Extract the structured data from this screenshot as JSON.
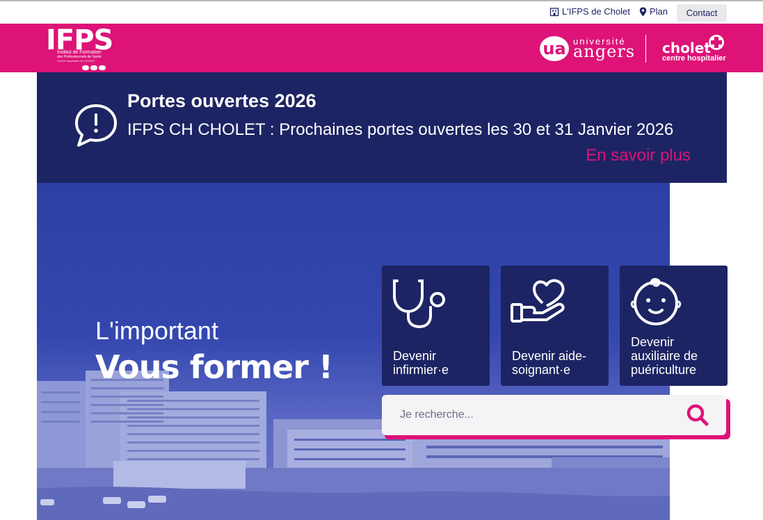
{
  "utility_nav": {
    "ifps_link": "L'IFPS de Cholet",
    "plan_link": "Plan",
    "contact_button": "Contact"
  },
  "branding": {
    "ifps_logo_letters": "IFPS",
    "ifps_logo_line1": "Institut de Formation",
    "ifps_logo_line2": "des Professionnels de Santé",
    "ifps_logo_line3": "Centre Hospitalier de CHOLET",
    "university_small": "université",
    "university_name": "angers",
    "university_initials": "ua",
    "hospital_name": "cholet",
    "hospital_sub": "centre hospitalier"
  },
  "announcement": {
    "title": "Portes ouvertes 2026",
    "text": "IFPS CH CHOLET : Prochaines portes ouvertes les 30 et 31 Janvier 2026",
    "link": "En savoir plus"
  },
  "hero": {
    "subtitle": "L'important",
    "title": "Vous former !"
  },
  "cards": [
    {
      "line1": "Devenir",
      "line2": "infirmier·e"
    },
    {
      "line1": "Devenir aide-",
      "line2": "soignant·e"
    },
    {
      "line1": "Devenir",
      "line2": "auxiliaire de",
      "line3": "puériculture"
    }
  ],
  "search": {
    "placeholder": "Je recherche..."
  },
  "colors": {
    "brand_pink": "#dd1377",
    "navy": "#1d2463",
    "hero_blue": "#2b3fa4"
  },
  "icons": {
    "announcement": "speech-bubble-exclamation-icon",
    "card1": "stethoscope-icon",
    "card2": "hand-heart-icon",
    "card3": "baby-face-icon",
    "search": "search-icon"
  }
}
